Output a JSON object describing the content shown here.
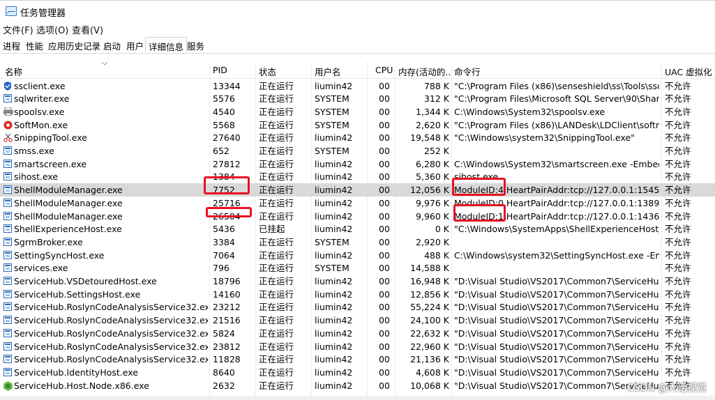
{
  "window": {
    "title": "任务管理器"
  },
  "menubar": {
    "items": [
      "文件(F)",
      "选项(O)",
      "查看(V)"
    ]
  },
  "tabs": [
    "进程",
    "性能",
    "应用历史记录",
    "启动",
    "用户",
    "详细信息",
    "服务"
  ],
  "active_tab": "详细信息",
  "columns": [
    "名称",
    "PID",
    "状态",
    "用户名",
    "CPU",
    "内存(活动的...",
    "命令行",
    "UAC 虚拟化"
  ],
  "rows": [
    {
      "icon": "shield-icon",
      "name": "ssclient.exe",
      "pid": "13344",
      "status": "正在运行",
      "user": "liumin42",
      "cpu": "00",
      "mem": "788 K",
      "cmd": "\"C:\\Program Files (x86)\\senseshield\\ss\\Tools\\sscli...",
      "uac": "不允许"
    },
    {
      "icon": "app-window-icon",
      "name": "sqlwriter.exe",
      "pid": "5576",
      "status": "正在运行",
      "user": "SYSTEM",
      "cpu": "00",
      "mem": "312 K",
      "cmd": "\"C:\\Program Files\\Microsoft SQL Server\\90\\Share...",
      "uac": "不允许"
    },
    {
      "icon": "printer-icon",
      "name": "spoolsv.exe",
      "pid": "4540",
      "status": "正在运行",
      "user": "SYSTEM",
      "cpu": "00",
      "mem": "1,344 K",
      "cmd": "C:\\Windows\\System32\\spoolsv.exe",
      "uac": "不允许"
    },
    {
      "icon": "softmon-icon",
      "name": "SoftMon.exe",
      "pid": "5568",
      "status": "正在运行",
      "user": "SYSTEM",
      "cpu": "00",
      "mem": "2,620 K",
      "cmd": "\"C:\\Program Files (x86)\\LANDesk\\LDClient\\softm...",
      "uac": "不允许"
    },
    {
      "icon": "snipping-tool-icon",
      "name": "SnippingTool.exe",
      "pid": "27640",
      "status": "正在运行",
      "user": "liumin42",
      "cpu": "00",
      "mem": "19,548 K",
      "cmd": "\"C:\\Windows\\system32\\SnippingTool.exe\"",
      "uac": "不允许"
    },
    {
      "icon": "app-window-icon",
      "name": "smss.exe",
      "pid": "652",
      "status": "正在运行",
      "user": "SYSTEM",
      "cpu": "00",
      "mem": "252 K",
      "cmd": "",
      "uac": "不允许"
    },
    {
      "icon": "app-window-icon",
      "name": "smartscreen.exe",
      "pid": "27812",
      "status": "正在运行",
      "user": "liumin42",
      "cpu": "00",
      "mem": "6,280 K",
      "cmd": "C:\\Windows\\System32\\smartscreen.exe -Embedd...",
      "uac": "不允许"
    },
    {
      "icon": "app-window-icon",
      "name": "sihost.exe",
      "pid": "1384",
      "status": "正在运行",
      "user": "liumin42",
      "cpu": "00",
      "mem": "5,360 K",
      "cmd": "sihost.exe",
      "uac": "不允许"
    },
    {
      "icon": "app-window-icon",
      "name": "ShellModuleManager.exe",
      "pid": "7752",
      "status": "正在运行",
      "user": "liumin42",
      "cpu": "00",
      "mem": "12,056 K",
      "cmd": "ModuleID:4 HeartPairAddr:tcp://127.0.0.1:1545;...",
      "uac": "不允许"
    },
    {
      "icon": "app-window-icon",
      "name": "ShellModuleManager.exe",
      "pid": "25716",
      "status": "正在运行",
      "user": "liumin42",
      "cpu": "00",
      "mem": "9,976 K",
      "cmd": "ModuleID:0 HeartPairAddr:tcp://127.0.0.1:1389;...",
      "uac": "不允许"
    },
    {
      "icon": "app-window-icon",
      "name": "ShellModuleManager.exe",
      "pid": "26504",
      "status": "正在运行",
      "user": "liumin42",
      "cpu": "00",
      "mem": "9,960 K",
      "cmd": "ModuleID:1 HeartPairAddr:tcp://127.0.0.1:1436;...",
      "uac": "不允许"
    },
    {
      "icon": "app-window-icon",
      "name": "ShellExperienceHost.exe",
      "pid": "5436",
      "status": "已挂起",
      "user": "liumin42",
      "cpu": "00",
      "mem": "0 K",
      "cmd": "\"C:\\Windows\\SystemApps\\ShellExperienceHost_c...",
      "uac": "不允许"
    },
    {
      "icon": "app-window-icon",
      "name": "SgrmBroker.exe",
      "pid": "3384",
      "status": "正在运行",
      "user": "SYSTEM",
      "cpu": "00",
      "mem": "2,920 K",
      "cmd": "",
      "uac": "不允许"
    },
    {
      "icon": "app-window-icon",
      "name": "SettingSyncHost.exe",
      "pid": "7064",
      "status": "正在运行",
      "user": "liumin42",
      "cpu": "00",
      "mem": "488 K",
      "cmd": "C:\\Windows\\system32\\SettingSyncHost.exe -Emb...",
      "uac": "不允许"
    },
    {
      "icon": "app-window-icon",
      "name": "services.exe",
      "pid": "796",
      "status": "正在运行",
      "user": "SYSTEM",
      "cpu": "00",
      "mem": "14,588 K",
      "cmd": "",
      "uac": "不允许"
    },
    {
      "icon": "app-window-icon",
      "name": "ServiceHub.VSDetouredHost.exe",
      "pid": "18796",
      "status": "正在运行",
      "user": "liumin42",
      "cpu": "00",
      "mem": "16,948 K",
      "cmd": "\"D:\\Visual Studio\\VS2017\\Common7\\ServiceHub\\...",
      "uac": "不允许"
    },
    {
      "icon": "app-window-icon",
      "name": "ServiceHub.SettingsHost.exe",
      "pid": "14160",
      "status": "正在运行",
      "user": "liumin42",
      "cpu": "00",
      "mem": "12,856 K",
      "cmd": "\"D:\\Visual Studio\\VS2017\\Common7\\ServiceHub\\...",
      "uac": "不允许"
    },
    {
      "icon": "app-window-icon",
      "name": "ServiceHub.RoslynCodeAnalysisService32.exe",
      "pid": "23212",
      "status": "正在运行",
      "user": "liumin42",
      "cpu": "00",
      "mem": "55,224 K",
      "cmd": "\"D:\\Visual Studio\\VS2017\\Common7\\ServiceHub\\...",
      "uac": "不允许"
    },
    {
      "icon": "app-window-icon",
      "name": "ServiceHub.RoslynCodeAnalysisService32.exe",
      "pid": "21516",
      "status": "正在运行",
      "user": "liumin42",
      "cpu": "00",
      "mem": "24,100 K",
      "cmd": "\"D:\\Visual Studio\\VS2017\\Common7\\ServiceHub\\...",
      "uac": "不允许"
    },
    {
      "icon": "app-window-icon",
      "name": "ServiceHub.RoslynCodeAnalysisService32.exe",
      "pid": "5824",
      "status": "正在运行",
      "user": "liumin42",
      "cpu": "00",
      "mem": "22,632 K",
      "cmd": "\"D:\\Visual Studio\\VS2017\\Common7\\ServiceHub\\...",
      "uac": "不允许"
    },
    {
      "icon": "app-window-icon",
      "name": "ServiceHub.RoslynCodeAnalysisService32.exe",
      "pid": "23812",
      "status": "正在运行",
      "user": "liumin42",
      "cpu": "00",
      "mem": "22,960 K",
      "cmd": "\"D:\\Visual Studio\\VS2017\\Common7\\ServiceHub\\...",
      "uac": "不允许"
    },
    {
      "icon": "app-window-icon",
      "name": "ServiceHub.RoslynCodeAnalysisService32.exe",
      "pid": "11828",
      "status": "正在运行",
      "user": "liumin42",
      "cpu": "00",
      "mem": "21,136 K",
      "cmd": "\"D:\\Visual Studio\\VS2017\\Common7\\ServiceHub\\...",
      "uac": "不允许"
    },
    {
      "icon": "app-window-icon",
      "name": "ServiceHub.IdentityHost.exe",
      "pid": "8640",
      "status": "正在运行",
      "user": "liumin42",
      "cpu": "00",
      "mem": "4,608 K",
      "cmd": "\"D:\\Visual Studio\\VS2017\\Common7\\ServiceHub\\...",
      "uac": "不允许"
    },
    {
      "icon": "nodejs-icon",
      "name": "ServiceHub.Host.Node.x86.exe",
      "pid": "2632",
      "status": "正在运行",
      "user": "liumin42",
      "cpu": "00",
      "mem": "10,068 K",
      "cmd": "\"D:\\Visual Studio\\VS2017\\Common7\\ServiceHub\\...",
      "uac": "不允许"
    }
  ],
  "selected_row": 8,
  "watermark": "CSDN @大话视觉",
  "colors": {
    "highlight": "#e81123",
    "selection": "#d9d9d9"
  }
}
